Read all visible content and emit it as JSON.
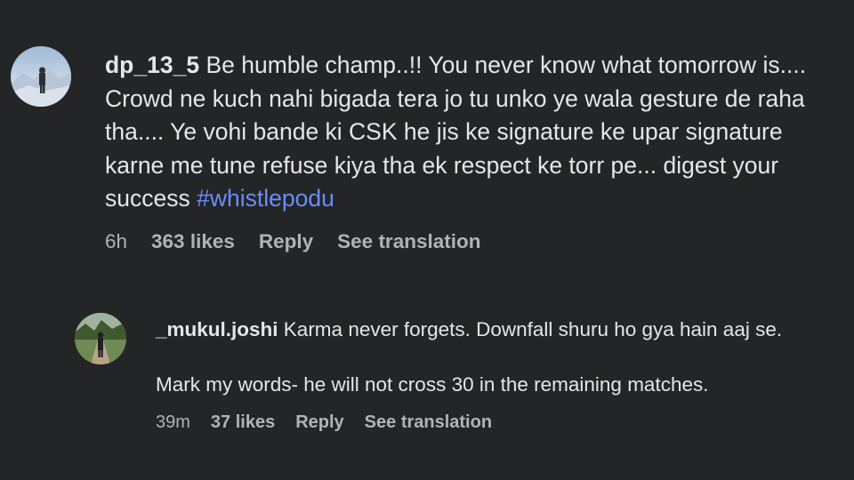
{
  "main_comment": {
    "username": "dp_13_5",
    "text_before_tag": "Be humble champ..!! You never know what tomorrow is.... Crowd ne kuch nahi bigada tera jo tu unko ye wala gesture de raha tha.... Ye vohi bande ki CSK he jis ke signature ke upar signature karne me tune refuse kiya tha ek respect ke torr pe... digest your success",
    "hashtag": "#whistlepodu",
    "time": "6h",
    "likes": "363 likes",
    "reply_label": "Reply",
    "translation_label": "See translation"
  },
  "reply_comment": {
    "username": "_mukul.joshi",
    "text_line1": "Karma never forgets. Downfall shuru ho gya hain aaj se.",
    "text_line2": "Mark my words- he will not cross 30 in the remaining matches.",
    "time": "39m",
    "likes": "37 likes",
    "reply_label": "Reply",
    "translation_label": "See translation"
  },
  "colors": {
    "background": "#242526",
    "text": "#e4e6eb",
    "meta": "#b0b3b8",
    "hashtag": "#6b8cff"
  }
}
